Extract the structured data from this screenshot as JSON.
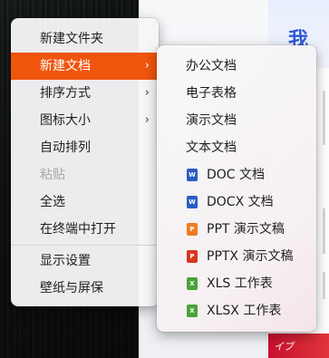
{
  "desktop": {
    "right_glyph": "我",
    "red_banner_text": "イブ"
  },
  "context_menu": {
    "items": [
      {
        "label": "新建文件夹"
      },
      {
        "label": "新建文档",
        "submenu": true,
        "active": true
      },
      {
        "label": "排序方式",
        "submenu": true
      },
      {
        "label": "图标大小",
        "submenu": true
      },
      {
        "label": "自动排列"
      },
      {
        "label": "粘贴",
        "disabled": true
      },
      {
        "label": "全选"
      },
      {
        "label": "在终端中打开"
      },
      {
        "label": "显示设置"
      },
      {
        "label": "壁纸与屏保"
      }
    ],
    "arrow_glyph": "›"
  },
  "submenu": {
    "items": [
      {
        "label": "办公文档"
      },
      {
        "label": "电子表格"
      },
      {
        "label": "演示文档"
      },
      {
        "label": "文本文档"
      },
      {
        "label": "DOC 文档",
        "icon": "word-doc-icon",
        "icon_text": "W",
        "color": "#2b5cc4"
      },
      {
        "label": "DOCX 文档",
        "icon": "word-docx-icon",
        "icon_text": "W",
        "color": "#2b5cc4"
      },
      {
        "label": "PPT 演示文稿",
        "icon": "presentation-ppt-icon",
        "icon_text": "P",
        "color": "#f07c24"
      },
      {
        "label": "PPTX 演示文稿",
        "icon": "powerpoint-pptx-icon",
        "icon_text": "P",
        "color": "#d9361e"
      },
      {
        "label": "XLS 工作表",
        "icon": "spreadsheet-xls-icon",
        "icon_text": "X",
        "color": "#4aa33a"
      },
      {
        "label": "XLSX 工作表",
        "icon": "spreadsheet-xlsx-icon",
        "icon_text": "X",
        "color": "#4aa33a"
      }
    ]
  },
  "colors": {
    "accent": "#f0550e"
  }
}
